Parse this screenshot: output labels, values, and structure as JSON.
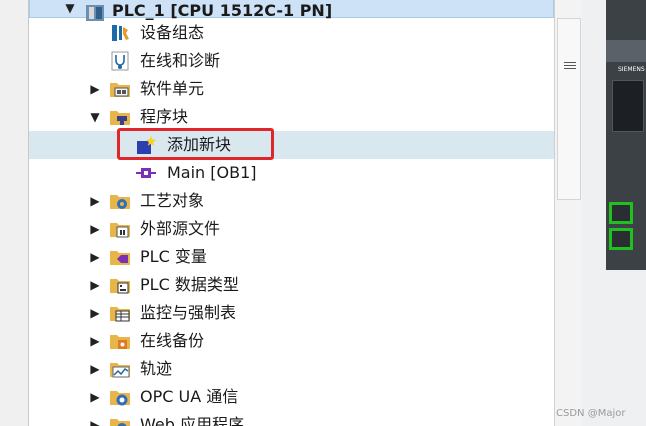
{
  "root": {
    "label": "PLC_1 [CPU 1512C-1 PN]"
  },
  "tree": {
    "items": [
      {
        "label": "设备组态"
      },
      {
        "label": "在线和诊断"
      },
      {
        "label": "软件单元"
      },
      {
        "label": "程序块"
      },
      {
        "label": "添加新块"
      },
      {
        "label": "Main [OB1]"
      },
      {
        "label": "工艺对象"
      },
      {
        "label": "外部源文件"
      },
      {
        "label": "PLC 变量"
      },
      {
        "label": "PLC 数据类型"
      },
      {
        "label": "监控与强制表"
      },
      {
        "label": "在线备份"
      },
      {
        "label": "轨迹"
      },
      {
        "label": "OPC UA 通信"
      },
      {
        "label": "Web 应用程序"
      }
    ]
  },
  "device": {
    "brand": "SIEMENS"
  },
  "watermark": "CSDN @Major"
}
